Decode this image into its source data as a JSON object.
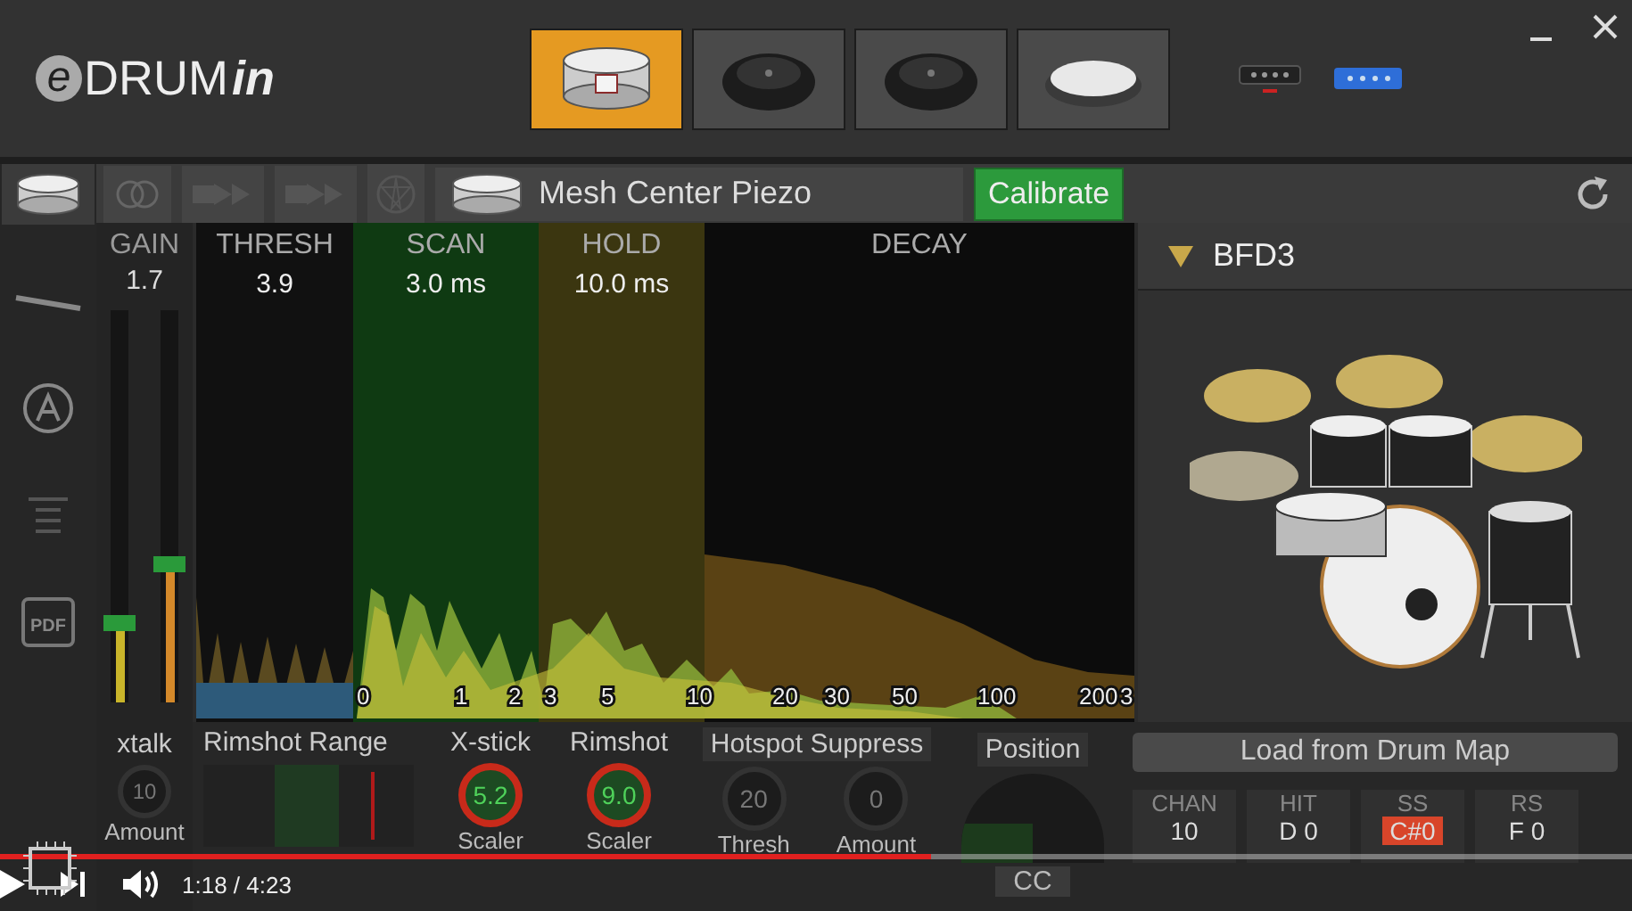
{
  "header": {
    "logo": {
      "letter": "e",
      "main": "DRUM",
      "suffix": "in"
    },
    "pads": [
      {
        "kind": "snare",
        "selected": true
      },
      {
        "kind": "cymbal",
        "selected": false
      },
      {
        "kind": "cymbal",
        "selected": false
      },
      {
        "kind": "pad",
        "selected": false
      }
    ]
  },
  "side_tabs": [
    {
      "kind": "snare",
      "selected": true
    },
    {
      "kind": "stick",
      "selected": false
    },
    {
      "kind": "letter",
      "selected": false
    },
    {
      "kind": "lines",
      "selected": false
    },
    {
      "kind": "pdf",
      "label": "PDF",
      "selected": false
    }
  ],
  "toolbar": {
    "pad_name": "Mesh Center Piezo",
    "calibrate": "Calibrate"
  },
  "gain": {
    "label": "GAIN",
    "value": "1.7",
    "meters": [
      {
        "level": 0.18
      },
      {
        "level": 0.33
      }
    ]
  },
  "graph": {
    "sections": [
      {
        "label": "THRESH",
        "value": "3.9"
      },
      {
        "label": "SCAN",
        "value": "3.0 ms"
      },
      {
        "label": "HOLD",
        "value": "10.0 ms"
      },
      {
        "label": "DECAY"
      }
    ],
    "axis_labels": [
      "0",
      "1",
      "2",
      "3",
      "5",
      "10",
      "20",
      "30",
      "50",
      "100",
      "200",
      "3"
    ]
  },
  "kit": {
    "name": "BFD3"
  },
  "xtalk": {
    "label": "xtalk",
    "value": "10",
    "caption": "Amount"
  },
  "rimshot_range": {
    "title": "Rimshot Range",
    "level": 0.8
  },
  "knobs": [
    {
      "title": "X-stick",
      "value": "5.2",
      "caption": "Scaler",
      "active": true
    },
    {
      "title": "Rimshot",
      "value": "9.0",
      "caption": "Scaler",
      "active": true
    }
  ],
  "hotspot": {
    "title": "Hotspot Suppress",
    "knobs": [
      {
        "value": "20",
        "caption": "Thresh"
      },
      {
        "value": "0",
        "caption": "Amount"
      }
    ]
  },
  "position": {
    "title": "Position",
    "button": "CC"
  },
  "drum_map": {
    "button": "Load from Drum Map",
    "cells": [
      {
        "label": "CHAN",
        "value": "10",
        "highlighted": false
      },
      {
        "label": "HIT",
        "value": "D 0",
        "highlighted": false
      },
      {
        "label": "SS",
        "value": "C#0",
        "highlighted": true
      },
      {
        "label": "RS",
        "value": "F 0",
        "highlighted": false
      }
    ]
  },
  "video": {
    "time": "1:18 / 4:23",
    "progress": {
      "level": 0.57
    }
  }
}
